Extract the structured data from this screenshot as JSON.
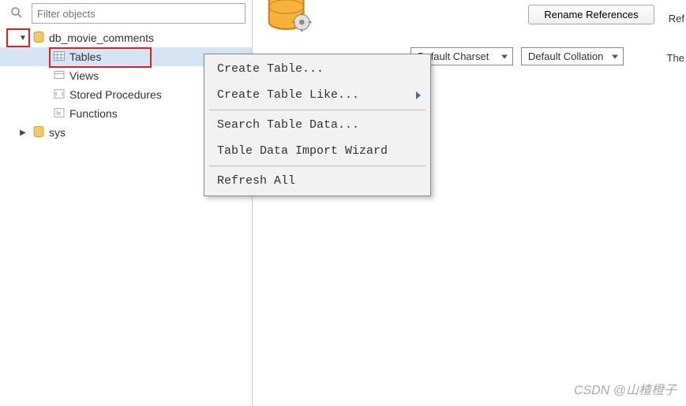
{
  "filter": {
    "placeholder": "Filter objects"
  },
  "tree": {
    "db": {
      "label": "db_movie_comments"
    },
    "tables": {
      "label": "Tables"
    },
    "views": {
      "label": "Views"
    },
    "procs": {
      "label": "Stored Procedures"
    },
    "functions": {
      "label": "Functions"
    },
    "sys": {
      "label": "sys"
    }
  },
  "context": {
    "create_table": "Create Table...",
    "create_like": "Create Table Like...",
    "search": "Search Table Data...",
    "import": "Table Data Import Wizard",
    "refresh": "Refresh All"
  },
  "right": {
    "rename_btn": "Rename References",
    "ref_label": "Ref",
    "the_label": "The",
    "charset": "Default Charset",
    "collation": "Default Collation"
  },
  "watermark": "CSDN @山楂橙子"
}
